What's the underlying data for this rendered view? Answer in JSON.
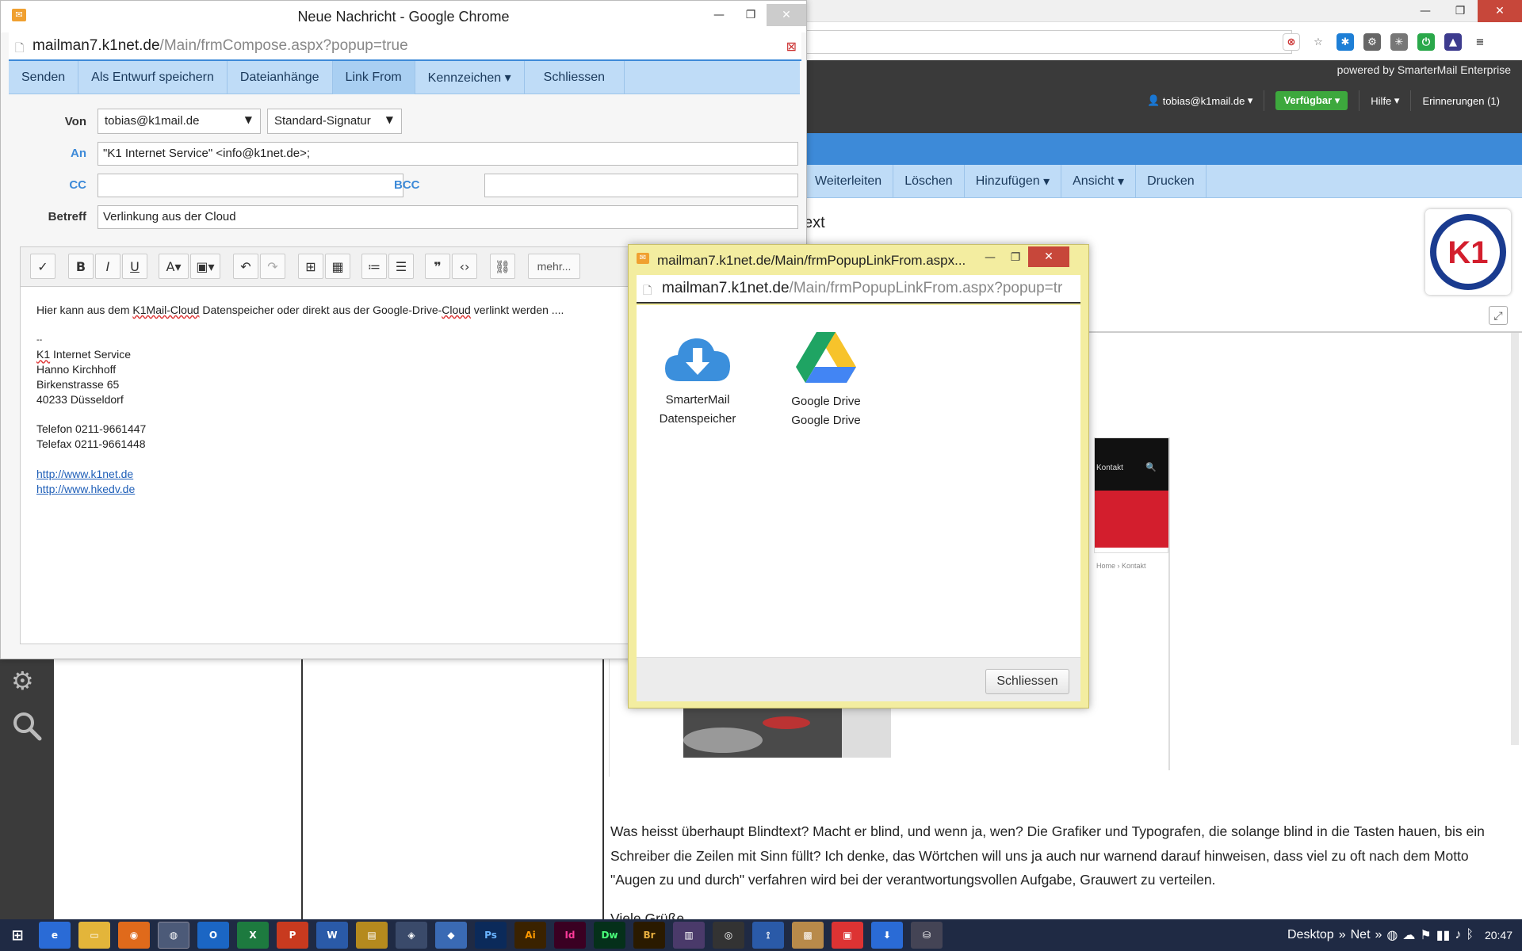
{
  "bg": {
    "powered": "powered by SmarterMail Enterprise",
    "user": "tobias@k1mail.de",
    "status": "Verfügbar",
    "help": "Hilfe",
    "reminders": "Erinnerungen (1)",
    "toolbar": [
      "Weiterleiten",
      "Löschen",
      "Hinzufügen",
      "Ansicht",
      "Drucken"
    ],
    "subject_fragment": "ext",
    "preview": {
      "nav": "Kontakt",
      "crumb": "Home › Kontakt"
    },
    "logo": "K1",
    "body": "Was heisst überhaupt Blindtext? Macht er blind, und wenn ja, wen? Die Grafiker und Typografen, die solange blind in die Tasten hauen, bis ein Schreiber die Zeilen mit Sinn füllt? Ich denke, das Wörtchen will uns ja auch nur warnend darauf hinweisen, dass viel zu oft nach dem Motto \"Augen zu und durch\" verfahren wird bei der verantwortungsvollen Aufgabe, Grauwert zu verteilen.",
    "body_tail": "Viele Grüße"
  },
  "compose": {
    "title": "Neue Nachricht - Google Chrome",
    "url_host": "mailman7.k1net.de",
    "url_path": "/Main/frmCompose.aspx?popup=true",
    "toolbar": [
      "Senden",
      "Als Entwurf speichern",
      "Dateianhänge",
      "Link From",
      "Kennzeichen ▾",
      "Schliessen"
    ],
    "labels": {
      "from": "Von",
      "to": "An",
      "cc": "CC",
      "bcc": "BCC",
      "subject": "Betreff"
    },
    "from": "tobias@k1mail.de",
    "signature": "Standard-Signatur",
    "to": "\"K1 Internet Service\" <info@k1net.de>;",
    "cc": "",
    "bcc": "",
    "subject": "Verlinkung aus der Cloud",
    "editor": {
      "more": "mehr...",
      "intro_a": "Hier kann aus dem ",
      "intro_cloud": "K1Mail-Cloud",
      "intro_b": " Datenspeicher oder direkt aus der Google-Drive-",
      "intro_cloud2": "Cloud",
      "intro_c": " verlinkt werden ....",
      "sigsep": "--",
      "sig_k1": "K1",
      "sig_line1": " Internet Service",
      "sig_line2": "Hanno Kirchhoff",
      "sig_line3": "Birkenstrasse 65",
      "sig_line4": "40233 Düsseldorf",
      "phone": "Telefon 0211-9661447",
      "fax": "Telefax 0211-9661448",
      "link1": "http://www.k1net.de",
      "link2": "http://www.hkedv.de"
    }
  },
  "popup": {
    "title": "mailman7.k1net.de/Main/frmPopupLinkFrom.aspx...",
    "url_host": "mailman7.k1net.de",
    "url_path": "/Main/frmPopupLinkFrom.aspx?popup=tr",
    "tiles": [
      {
        "line1": "SmarterMail",
        "line2": "Datenspeicher"
      },
      {
        "line1": "Google Drive",
        "line2": "Google Drive"
      }
    ],
    "close": "Schliessen"
  },
  "taskbar": {
    "desktop": "Desktop",
    "net": "Net",
    "time": "20:47"
  },
  "colors": {
    "accent": "#3d8ad8",
    "toolbar": "#bfdcf7",
    "popup_frame": "#f3eda0",
    "status": "#3da83d"
  }
}
